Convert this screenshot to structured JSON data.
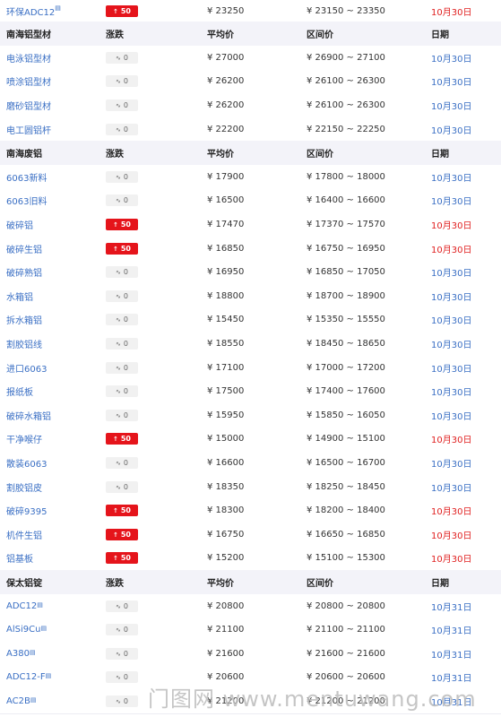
{
  "colors": {
    "up": "#e5141b",
    "date_blue": "#3a6fc4",
    "date_red": "#e02020",
    "header_bg": "#f3f3f9"
  },
  "top_row": {
    "name": "环保ADC12",
    "change": "50",
    "avg": "¥ 23250",
    "range": "¥ 23150 ~ 23350",
    "date": "10月30日",
    "date_color": "red"
  },
  "section_nanhai_profile": {
    "header": {
      "name": "南海铝型材",
      "change": "涨跌",
      "avg": "平均价",
      "range": "区间价",
      "date": "日期"
    },
    "rows": [
      {
        "name": "电泳铝型材",
        "change": "0",
        "avg": "¥ 27000",
        "range": "¥ 26900 ~ 27100",
        "date": "10月30日"
      },
      {
        "name": "喷涂铝型材",
        "change": "0",
        "avg": "¥ 26200",
        "range": "¥ 26100 ~ 26300",
        "date": "10月30日"
      },
      {
        "name": "磨砂铝型材",
        "change": "0",
        "avg": "¥ 26200",
        "range": "¥ 26100 ~ 26300",
        "date": "10月30日"
      },
      {
        "name": "电工圆铝杆",
        "change": "0",
        "avg": "¥ 22200",
        "range": "¥ 22150 ~ 22250",
        "date": "10月30日"
      }
    ]
  },
  "section_nanhai_scrap": {
    "header": {
      "name": "南海废铝",
      "change": "涨跌",
      "avg": "平均价",
      "range": "区间价",
      "date": "日期"
    },
    "rows": [
      {
        "name": "6063新料",
        "change": "0",
        "avg": "¥ 17900",
        "range": "¥ 17800 ~ 18000",
        "date": "10月30日"
      },
      {
        "name": "6063旧料",
        "change": "0",
        "avg": "¥ 16500",
        "range": "¥ 16400 ~ 16600",
        "date": "10月30日"
      },
      {
        "name": "破碎铝",
        "change": "50",
        "avg": "¥ 17470",
        "range": "¥ 17370 ~ 17570",
        "date": "10月30日"
      },
      {
        "name": "破碎生铝",
        "change": "50",
        "avg": "¥ 16850",
        "range": "¥ 16750 ~ 16950",
        "date": "10月30日"
      },
      {
        "name": "破碎熟铝",
        "change": "0",
        "avg": "¥ 16950",
        "range": "¥ 16850 ~ 17050",
        "date": "10月30日"
      },
      {
        "name": "水箱铝",
        "change": "0",
        "avg": "¥ 18800",
        "range": "¥ 18700 ~ 18900",
        "date": "10月30日"
      },
      {
        "name": "拆水箱铝",
        "change": "0",
        "avg": "¥ 15450",
        "range": "¥ 15350 ~ 15550",
        "date": "10月30日"
      },
      {
        "name": "割胶铝线",
        "change": "0",
        "avg": "¥ 18550",
        "range": "¥ 18450 ~ 18650",
        "date": "10月30日"
      },
      {
        "name": "进口6063",
        "change": "0",
        "avg": "¥ 17100",
        "range": "¥ 17000 ~ 17200",
        "date": "10月30日"
      },
      {
        "name": "报纸板",
        "change": "0",
        "avg": "¥ 17500",
        "range": "¥ 17400 ~ 17600",
        "date": "10月30日"
      },
      {
        "name": "破碎水箱铝",
        "change": "0",
        "avg": "¥ 15950",
        "range": "¥ 15850 ~ 16050",
        "date": "10月30日"
      },
      {
        "name": "干净喉仔",
        "change": "50",
        "avg": "¥ 15000",
        "range": "¥ 14900 ~ 15100",
        "date": "10月30日"
      },
      {
        "name": "散装6063",
        "change": "0",
        "avg": "¥ 16600",
        "range": "¥ 16500 ~ 16700",
        "date": "10月30日"
      },
      {
        "name": "割胶铝皮",
        "change": "0",
        "avg": "¥ 18350",
        "range": "¥ 18250 ~ 18450",
        "date": "10月30日"
      },
      {
        "name": "破碎9395",
        "change": "50",
        "avg": "¥ 18300",
        "range": "¥ 18200 ~ 18400",
        "date": "10月30日"
      },
      {
        "name": "机件生铝",
        "change": "50",
        "avg": "¥ 16750",
        "range": "¥ 16650 ~ 16850",
        "date": "10月30日"
      },
      {
        "name": "铝基板",
        "change": "50",
        "avg": "¥ 15200",
        "range": "¥ 15100 ~ 15300",
        "date": "10月30日"
      }
    ]
  },
  "section_baotai": {
    "header": {
      "name": "保太铝锭",
      "change": "涨跌",
      "avg": "平均价",
      "range": "区间价",
      "date": "日期"
    },
    "rows": [
      {
        "name": "ADC12",
        "change": "0",
        "avg": "¥ 20800",
        "range": "¥ 20800 ~ 20800",
        "date": "10月31日"
      },
      {
        "name": "AlSi9Cu",
        "change": "0",
        "avg": "¥ 21100",
        "range": "¥ 21100 ~ 21100",
        "date": "10月31日"
      },
      {
        "name": "A380",
        "change": "0",
        "avg": "¥ 21600",
        "range": "¥ 21600 ~ 21600",
        "date": "10月31日"
      },
      {
        "name": "ADC12-F",
        "change": "0",
        "avg": "¥ 20600",
        "range": "¥ 20600 ~ 20600",
        "date": "10月31日"
      },
      {
        "name": "AC2B",
        "change": "0",
        "avg": "¥ 21200",
        "range": "¥ 21200 ~ 21200",
        "date": "10月31日"
      }
    ]
  },
  "watermark": "门图网 www.mentuwang.com"
}
